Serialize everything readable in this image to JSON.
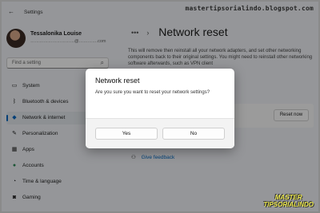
{
  "window": {
    "title": "Settings",
    "back_icon": "back-arrow-icon"
  },
  "watermark": "mastertipsorialindo.blogspot.com",
  "profile": {
    "name": "Tessalonika Louise",
    "email": "…………………………@………….com"
  },
  "search": {
    "placeholder": "Find a setting",
    "icon": "search-icon"
  },
  "nav": {
    "items": [
      {
        "label": "System",
        "icon": "monitor-icon",
        "glyph": "▭",
        "active": false
      },
      {
        "label": "Bluetooth & devices",
        "icon": "bluetooth-icon",
        "glyph": "ᛒ",
        "active": false
      },
      {
        "label": "Network & internet",
        "icon": "wifi-icon",
        "glyph": "◆",
        "active": true
      },
      {
        "label": "Personalization",
        "icon": "brush-icon",
        "glyph": "✎",
        "active": false
      },
      {
        "label": "Apps",
        "icon": "apps-icon",
        "glyph": "▦",
        "active": false
      },
      {
        "label": "Accounts",
        "icon": "person-icon",
        "glyph": "●",
        "active": false
      },
      {
        "label": "Time & language",
        "icon": "clock-icon",
        "glyph": "◔",
        "active": false
      },
      {
        "label": "Gaming",
        "icon": "gamepad-icon",
        "glyph": "◙",
        "active": false
      }
    ]
  },
  "content": {
    "breadcrumb_more": "•••",
    "breadcrumb_sep": "›",
    "title": "Network reset",
    "description": "This will remove then reinstall all your network adapters, and set other networking components back to their original settings. You might need to reinstall other networking software afterwards, such as VPN client",
    "reset_button": "Reset now",
    "feedback": "Give feedback"
  },
  "dialog": {
    "title": "Network reset",
    "message": "Are you sure you want to reset your network settings?",
    "yes": "Yes",
    "no": "No"
  },
  "logo": {
    "line1": "MASTER",
    "line2": "TIPSORIALINDO"
  },
  "colors": {
    "accent": "#0067c0",
    "background": "#f0f3f7",
    "overlay": "rgba(0,0,0,0.38)"
  }
}
